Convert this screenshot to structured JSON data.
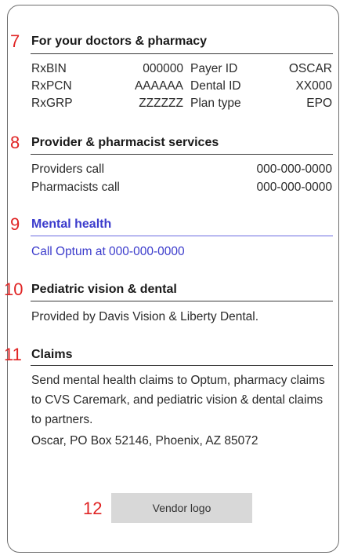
{
  "sections": {
    "doctors_pharmacy": {
      "marker": "7",
      "title": "For your doctors & pharmacy",
      "rows": [
        {
          "k1": "RxBIN",
          "v1": "000000",
          "k2": "Payer ID",
          "v2": "OSCAR"
        },
        {
          "k1": "RxPCN",
          "v1": "AAAAAA",
          "k2": "Dental ID",
          "v2": "XX000"
        },
        {
          "k1": "RxGRP",
          "v1": "ZZZZZZ",
          "k2": "Plan type",
          "v2": "EPO"
        }
      ]
    },
    "provider_services": {
      "marker": "8",
      "title": "Provider & pharmacist services",
      "rows": [
        {
          "label": "Providers call",
          "value": "000-000-0000"
        },
        {
          "label": "Pharmacists call",
          "value": "000-000-0000"
        }
      ]
    },
    "mental_health": {
      "marker": "9",
      "title": "Mental health",
      "text": "Call Optum at 000-000-0000",
      "accent_color": "#3b3bcc"
    },
    "pediatric": {
      "marker": "10",
      "title": "Pediatric vision & dental",
      "text": "Provided by Davis Vision & Liberty Dental."
    },
    "claims": {
      "marker": "11",
      "title": "Claims",
      "text": "Send mental health claims to Optum, pharmacy claims to CVS Caremark, and pediatric vision & dental claims to partners.",
      "address": "Oscar, PO Box 52146, Phoenix, AZ 85072"
    },
    "vendor": {
      "marker": "12",
      "label": "Vendor logo"
    }
  },
  "marker_color": "#e02424"
}
